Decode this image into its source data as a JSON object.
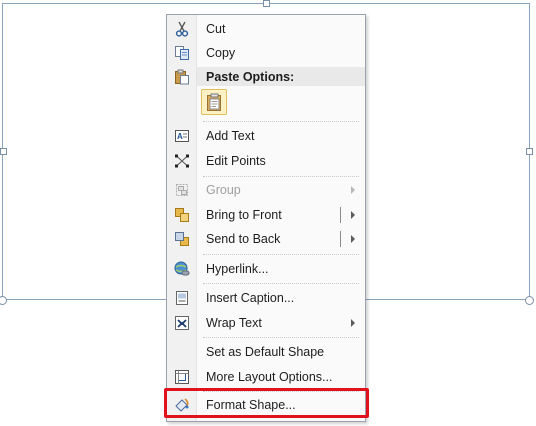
{
  "menu": {
    "items": [
      {
        "label": "Cut",
        "icon": "scissors-icon"
      },
      {
        "label": "Copy",
        "icon": "copy-icon"
      },
      {
        "label": "Paste Options:",
        "icon": "paste-icon"
      },
      {
        "label": "Add Text",
        "icon": "add-text-icon"
      },
      {
        "label": "Edit Points",
        "icon": "edit-points-icon"
      },
      {
        "label": "Group",
        "icon": "group-icon",
        "disabled": true,
        "submenu": true
      },
      {
        "label": "Bring to Front",
        "icon": "bring-to-front-icon",
        "split": true
      },
      {
        "label": "Send to Back",
        "icon": "send-to-back-icon",
        "split": true
      },
      {
        "label": "Hyperlink...",
        "icon": "hyperlink-icon"
      },
      {
        "label": "Insert Caption...",
        "icon": "insert-caption-icon"
      },
      {
        "label": "Wrap Text",
        "icon": "wrap-text-icon",
        "submenu": true
      },
      {
        "label": "Set as Default Shape",
        "icon": ""
      },
      {
        "label": "More Layout Options...",
        "icon": "layout-options-icon"
      },
      {
        "label": "Format Shape...",
        "icon": "format-shape-icon"
      }
    ],
    "paste_button_icon": "keep-source-formatting-icon"
  },
  "annotation": {
    "color": "#e1121c",
    "target": "Format Shape..."
  }
}
